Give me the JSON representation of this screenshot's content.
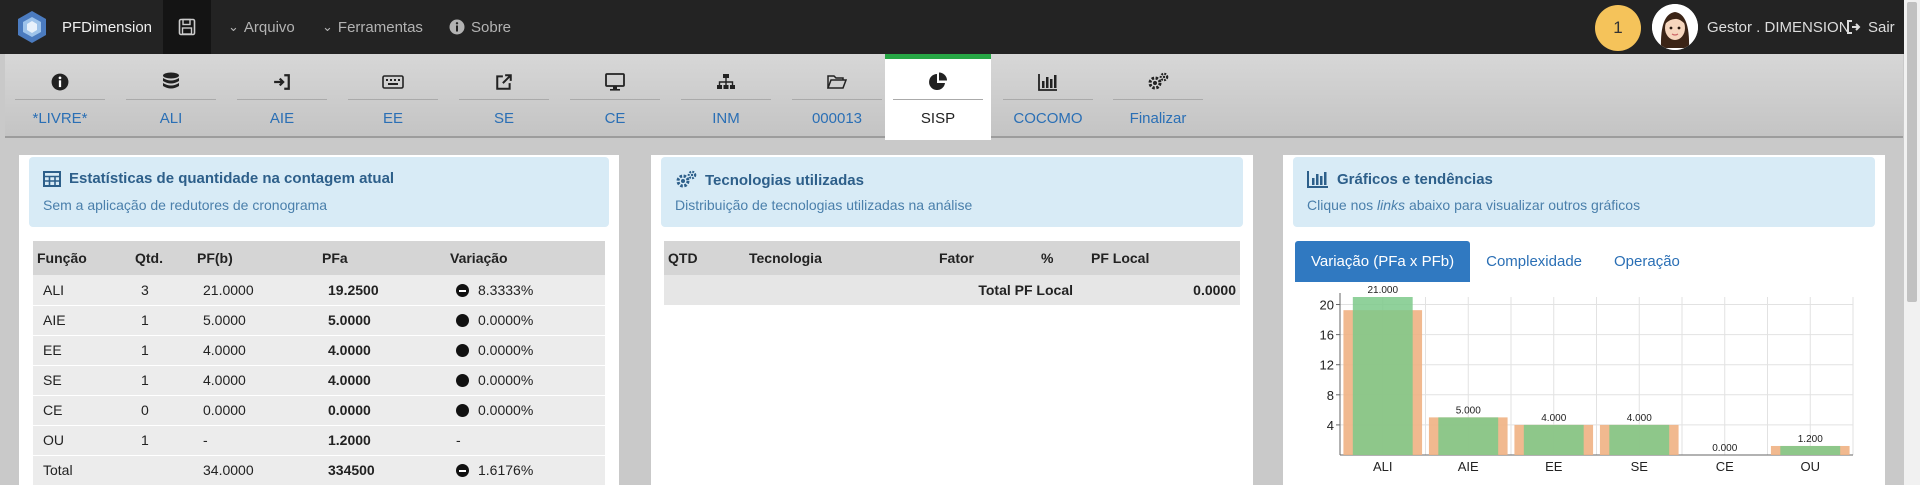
{
  "app": {
    "name": "PFDimension"
  },
  "menu": {
    "arquivo": "Arquivo",
    "ferramentas": "Ferramentas",
    "sobre": "Sobre"
  },
  "user": {
    "notifications": "1",
    "name": "Gestor . DIMENSION",
    "logout": "Sair"
  },
  "tabs": [
    {
      "label": "*LIVRE*",
      "icon": "info-icon"
    },
    {
      "label": "ALI",
      "icon": "database-icon"
    },
    {
      "label": "AIE",
      "icon": "sign-in-icon"
    },
    {
      "label": "EE",
      "icon": "keyboard-icon"
    },
    {
      "label": "SE",
      "icon": "external-link-icon"
    },
    {
      "label": "CE",
      "icon": "monitor-icon"
    },
    {
      "label": "INM",
      "icon": "sitemap-icon"
    },
    {
      "label": "000013",
      "icon": "folder-open-icon"
    },
    {
      "label": "SISP",
      "icon": "pie-chart-icon",
      "active": true
    },
    {
      "label": "COCOMO",
      "icon": "bar-chart-icon"
    },
    {
      "label": "Finalizar",
      "icon": "gears-icon"
    }
  ],
  "stats": {
    "title": "Estatísticas de quantidade na contagem atual",
    "subtitle": "Sem a aplicação de redutores de cronograma",
    "headers": [
      "Função",
      "Qtd.",
      "PF(b)",
      "PFa",
      "Variação"
    ],
    "rows": [
      {
        "funcao": "ALI",
        "qtd": "3",
        "pfb": "21.0000",
        "pfa": "19.2500",
        "variacao": "8.3333%",
        "icon": "minus"
      },
      {
        "funcao": "AIE",
        "qtd": "1",
        "pfb": "5.0000",
        "pfa": "5.0000",
        "variacao": "0.0000%",
        "icon": "dot"
      },
      {
        "funcao": "EE",
        "qtd": "1",
        "pfb": "4.0000",
        "pfa": "4.0000",
        "variacao": "0.0000%",
        "icon": "dot"
      },
      {
        "funcao": "SE",
        "qtd": "1",
        "pfb": "4.0000",
        "pfa": "4.0000",
        "variacao": "0.0000%",
        "icon": "dot"
      },
      {
        "funcao": "CE",
        "qtd": "0",
        "pfb": "0.0000",
        "pfa": "0.0000",
        "variacao": "0.0000%",
        "icon": "dot"
      },
      {
        "funcao": "OU",
        "qtd": "1",
        "pfb": "-",
        "pfa": "1.2000",
        "variacao": "-",
        "icon": ""
      }
    ],
    "total": {
      "funcao": "Total",
      "pfb": "34.0000",
      "pfa": "334500",
      "variacao": "1.6176%",
      "icon": "minus"
    }
  },
  "tech": {
    "title": "Tecnologias utilizadas",
    "subtitle": "Distribuição de tecnologias utilizadas na análise",
    "headers": [
      "QTD",
      "Tecnologia",
      "Fator",
      "%",
      "PF Local"
    ],
    "total_label": "Total PF Local",
    "total_value": "0.0000"
  },
  "charts": {
    "title": "Gráficos e tendências",
    "subtitle_pre": "Clique nos ",
    "subtitle_em": "links",
    "subtitle_post": " abaixo para visualizar outros gráficos",
    "tabs": [
      "Variação (PFa x PFb)",
      "Complexidade",
      "Operação"
    ]
  },
  "colors": {
    "pfb": "#f0b183",
    "pfa": "#7cc98a",
    "accent": "#3079c1",
    "active_tab": "#27a745"
  },
  "chart_data": {
    "type": "bar",
    "categories": [
      "ALI",
      "AIE",
      "EE",
      "SE",
      "CE",
      "OU"
    ],
    "series": [
      {
        "values": [
          19.25,
          5.0,
          4.0,
          4.0,
          0.0,
          1.2
        ]
      },
      {
        "values": [
          21.0,
          5.0,
          4.0,
          4.0,
          0.0,
          1.2
        ]
      }
    ],
    "data_labels": [
      "21.000",
      "5.000",
      "4.000",
      "4.000",
      "0.000",
      "1.200"
    ],
    "yticks": [
      4,
      8,
      12,
      16,
      20
    ],
    "ylim": [
      0,
      21
    ],
    "grid": true
  }
}
